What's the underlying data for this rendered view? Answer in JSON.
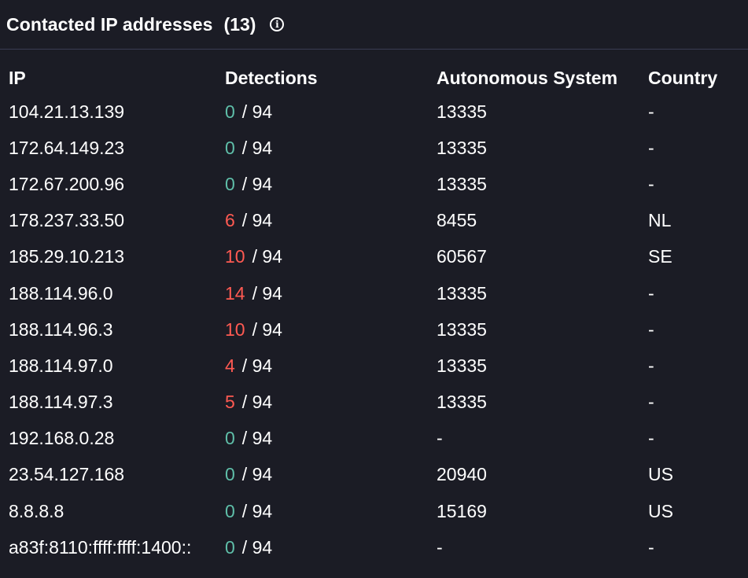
{
  "panel": {
    "title": "Contacted IP addresses",
    "count": "(13)",
    "info_icon": "info-icon"
  },
  "colors": {
    "background": "#1b1c25",
    "clean": "#5fbfa9",
    "malicious": "#ff5a52"
  },
  "table": {
    "headers": {
      "ip": "IP",
      "detections": "Detections",
      "as": "Autonomous System",
      "country": "Country"
    },
    "rows": [
      {
        "ip": "104.21.13.139",
        "det": "0",
        "total": "/ 94",
        "as": "13335",
        "country": "-"
      },
      {
        "ip": "172.64.149.23",
        "det": "0",
        "total": "/ 94",
        "as": "13335",
        "country": "-"
      },
      {
        "ip": "172.67.200.96",
        "det": "0",
        "total": "/ 94",
        "as": "13335",
        "country": "-"
      },
      {
        "ip": "178.237.33.50",
        "det": "6",
        "total": "/ 94",
        "as": "8455",
        "country": "NL"
      },
      {
        "ip": "185.29.10.213",
        "det": "10",
        "total": "/ 94",
        "as": "60567",
        "country": "SE"
      },
      {
        "ip": "188.114.96.0",
        "det": "14",
        "total": "/ 94",
        "as": "13335",
        "country": "-"
      },
      {
        "ip": "188.114.96.3",
        "det": "10",
        "total": "/ 94",
        "as": "13335",
        "country": "-"
      },
      {
        "ip": "188.114.97.0",
        "det": "4",
        "total": "/ 94",
        "as": "13335",
        "country": "-"
      },
      {
        "ip": "188.114.97.3",
        "det": "5",
        "total": "/ 94",
        "as": "13335",
        "country": "-"
      },
      {
        "ip": "192.168.0.28",
        "det": "0",
        "total": "/ 94",
        "as": "-",
        "country": "-"
      },
      {
        "ip": "23.54.127.168",
        "det": "0",
        "total": "/ 94",
        "as": "20940",
        "country": "US"
      },
      {
        "ip": "8.8.8.8",
        "det": "0",
        "total": "/ 94",
        "as": "15169",
        "country": "US"
      },
      {
        "ip": "a83f:8110:ffff:ffff:1400::",
        "det": "0",
        "total": "/ 94",
        "as": "-",
        "country": "-"
      }
    ]
  }
}
